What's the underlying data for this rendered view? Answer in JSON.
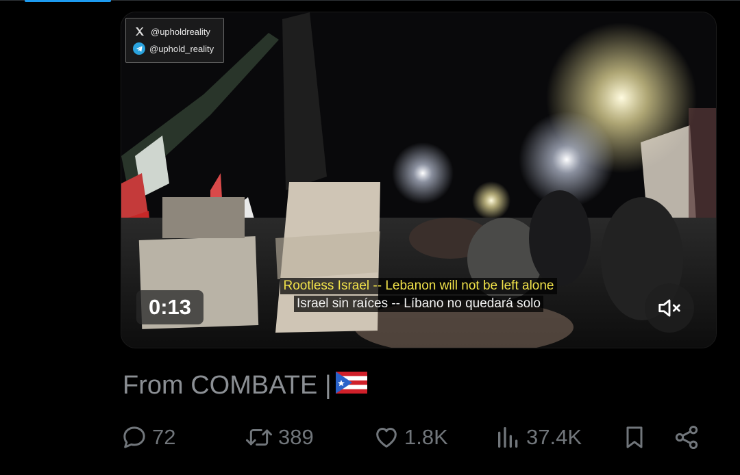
{
  "watermark": {
    "x_handle": "@upholdreality",
    "telegram_handle": "@uphold_reality",
    "x_icon": "x-logo-icon",
    "telegram_icon": "telegram-icon"
  },
  "video": {
    "subtitle_en": "Rootless Israel -- Lebanon will not be left alone",
    "subtitle_es": "Israel sin raíces -- Líbano no quedará solo",
    "duration": "0:13",
    "mute_icon": "speaker-muted-icon"
  },
  "caption": {
    "text": "From COMBATE |",
    "flag_icon": "puerto-rico-flag-icon"
  },
  "actions": {
    "replies": "72",
    "reposts": "389",
    "likes": "1.8K",
    "views": "37.4K"
  },
  "colors": {
    "accent": "#1d9bf0",
    "muted_text": "#71767b",
    "caption_text": "#8b8f94",
    "subtitle_yellow": "#f2e34a"
  }
}
